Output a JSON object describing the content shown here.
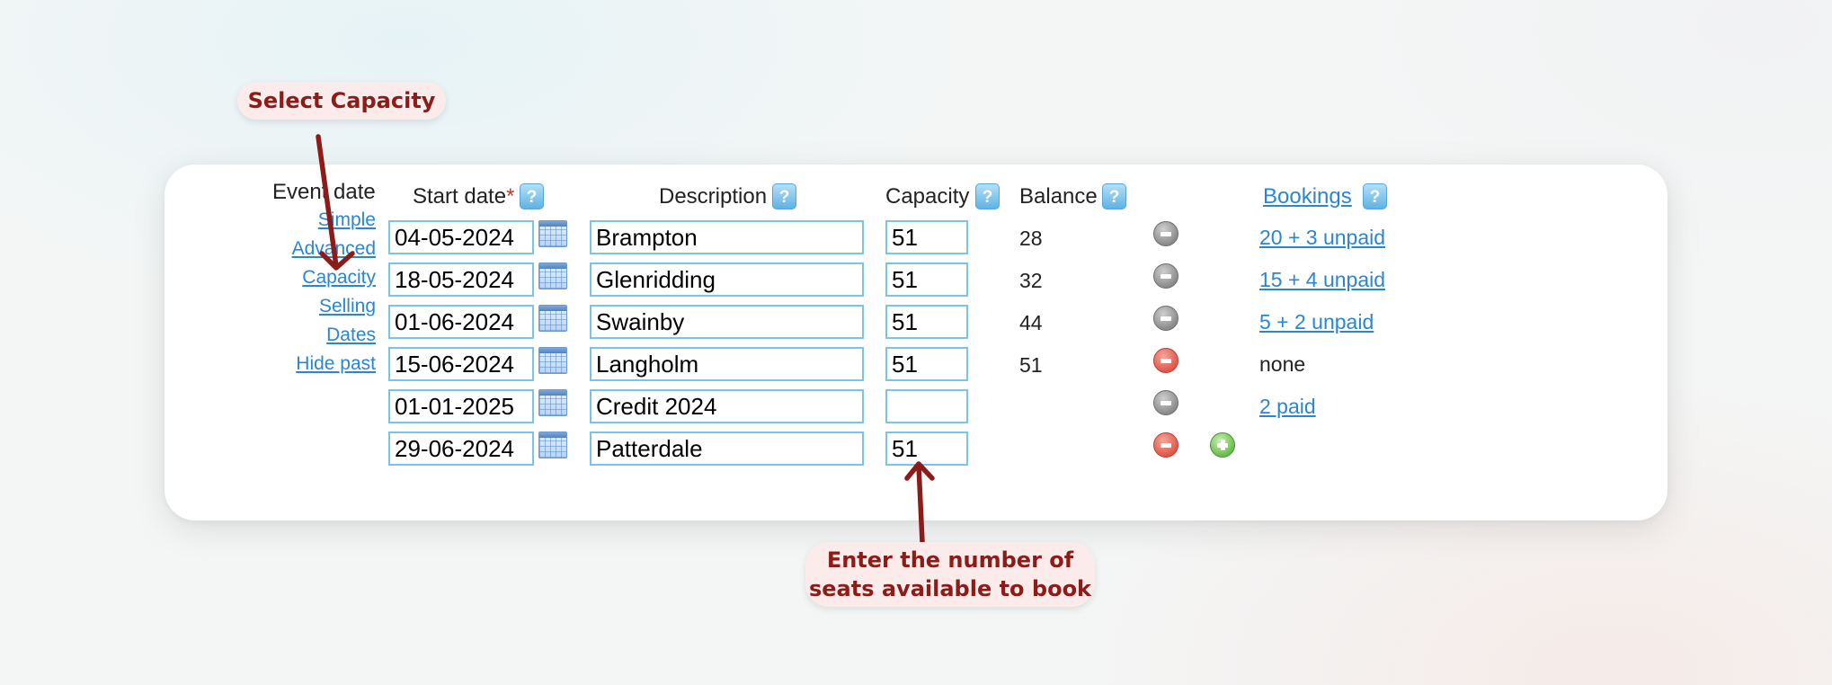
{
  "header": {
    "event_date": "Event date",
    "start_date": "Start date",
    "required_mark": "*",
    "description": "Description",
    "capacity": "Capacity",
    "balance": "Balance",
    "bookings": "Bookings",
    "help_glyph": "?"
  },
  "nav": {
    "simple": "Simple",
    "advanced": "Advanced",
    "capacity": "Capacity",
    "selling": "Selling",
    "dates": "Dates",
    "hide_past": "Hide past"
  },
  "rows": [
    {
      "date": "04-05-2024",
      "description": "Brampton",
      "capacity": "51",
      "balance": "28",
      "delete_icon": "grey",
      "bookings": "20 + 3 unpaid"
    },
    {
      "date": "18-05-2024",
      "description": "Glenridding",
      "capacity": "51",
      "balance": "32",
      "delete_icon": "grey",
      "bookings": "15 + 4 unpaid"
    },
    {
      "date": "01-06-2024",
      "description": "Swainby",
      "capacity": "51",
      "balance": "44",
      "delete_icon": "grey",
      "bookings": "5 + 2 unpaid"
    },
    {
      "date": "15-06-2024",
      "description": "Langholm",
      "capacity": "51",
      "balance": "51",
      "delete_icon": "red",
      "bookings": "none"
    },
    {
      "date": "01-01-2025",
      "description": "Credit 2024",
      "capacity": "",
      "balance": "",
      "delete_icon": "grey",
      "bookings": "2 paid"
    },
    {
      "date": "29-06-2024",
      "description": "Patterdale",
      "capacity": "51",
      "balance": "",
      "delete_icon": "red",
      "bookings": ""
    }
  ],
  "annotations": {
    "select_capacity": "Select Capacity",
    "enter_seats_line1": "Enter the number of",
    "enter_seats_line2": "seats available to book"
  },
  "icons": {
    "help": "help-icon",
    "calendar": "calendar-icon",
    "delete": "minus-circle-icon",
    "add": "plus-circle-icon"
  },
  "colors": {
    "link": "#2a86d3",
    "input_border": "#7cc4e6",
    "annotation_text": "#8b1c17",
    "annotation_bg": "#fbeceb",
    "arrow": "#8b1c17",
    "required": "#c0392b"
  }
}
